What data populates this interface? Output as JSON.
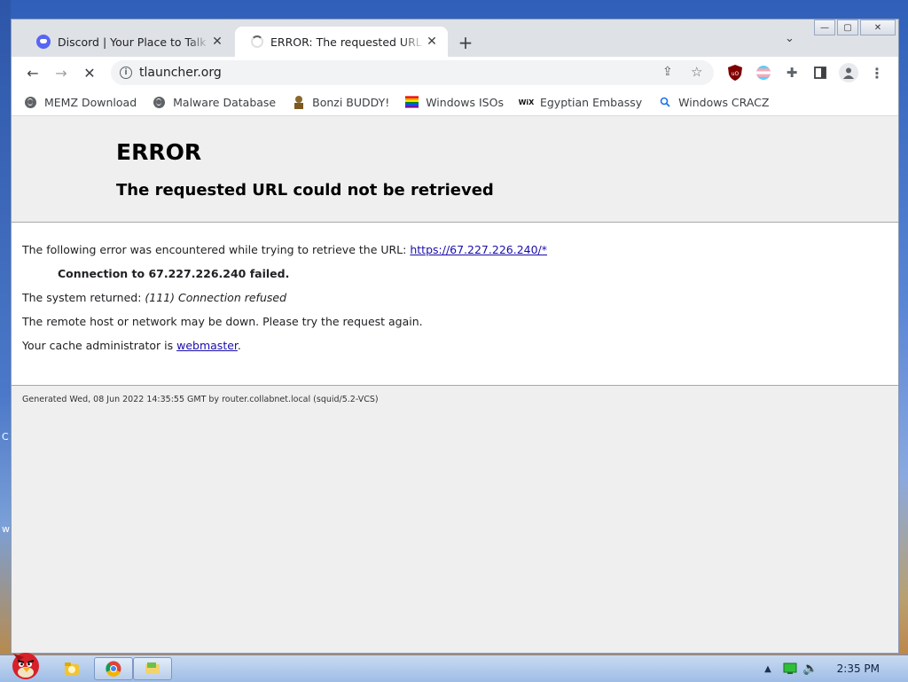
{
  "desktop": {
    "left_letter_1": "C",
    "left_letter_2": "w"
  },
  "browser": {
    "tabs": [
      {
        "title": "Discord | Your Place to Talk and Hang Out",
        "active": false
      },
      {
        "title": "ERROR: The requested URL could not be retrieved",
        "active": true
      }
    ],
    "new_tab_label": "+",
    "address": "tlauncher.org",
    "bookmarks": [
      {
        "label": "MEMZ Download",
        "icon": "globe-icon"
      },
      {
        "label": "Malware Database",
        "icon": "globe-icon"
      },
      {
        "label": "Bonzi BUDDY!",
        "icon": "bonzi-icon"
      },
      {
        "label": "Windows ISOs",
        "icon": "rainbow-flag-icon"
      },
      {
        "label": "Egyptian Embassy",
        "icon": "wix-icon"
      },
      {
        "label": "Windows CRACZ",
        "icon": "search-icon"
      }
    ],
    "wix_text": "WiX",
    "ublock_text": "uO"
  },
  "page": {
    "title": "ERROR",
    "subtitle": "The requested URL could not be retrieved",
    "line1_prefix": "The following error was encountered while trying to retrieve the URL: ",
    "line1_link": "https://67.227.226.240/*",
    "line2": "Connection to 67.227.226.240 failed.",
    "line3_prefix": "The system returned: ",
    "line3_em": "(111) Connection refused",
    "line4": "The remote host or network may be down. Please try the request again.",
    "line5_prefix": "Your cache administrator is ",
    "line5_link": "webmaster",
    "line5_suffix": ".",
    "footer": "Generated Wed, 08 Jun 2022 14:35:55 GMT by router.collabnet.local (squid/5.2-VCS)"
  },
  "taskbar": {
    "clock": "2:35 PM"
  }
}
